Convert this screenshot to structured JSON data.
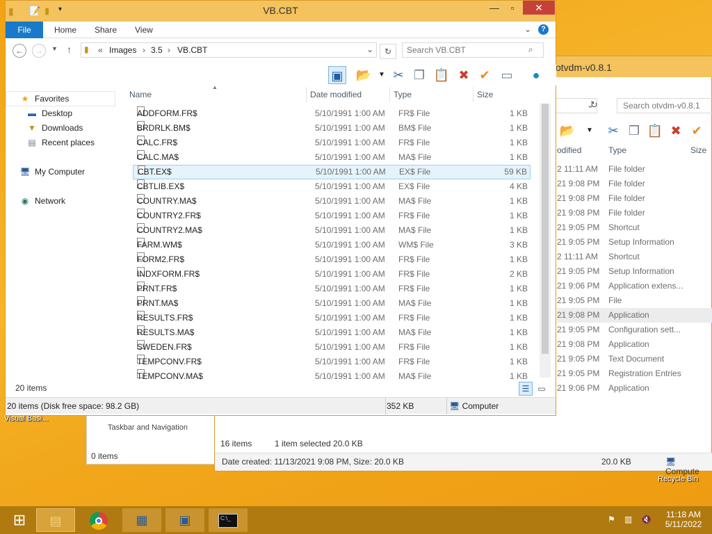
{
  "desktop": {
    "recycle_bin": "Recycle Bin",
    "visual_basic_label": "Visual Basi...",
    "taskbar_nav_label": "Taskbar and Navigation",
    "back_window_items": "0 items"
  },
  "bg_window": {
    "title": "otvdm-v0.8.1",
    "search_placeholder": "Search otvdm-v0.8.1",
    "col_modified": "odified",
    "col_type": "Type",
    "col_size": "Size",
    "rows": [
      {
        "date": "2 11:11 AM",
        "type": "File folder"
      },
      {
        "date": "21 9:08 PM",
        "type": "File folder"
      },
      {
        "date": "21 9:08 PM",
        "type": "File folder"
      },
      {
        "date": "21 9:08 PM",
        "type": "File folder"
      },
      {
        "date": "21 9:05 PM",
        "type": "Shortcut"
      },
      {
        "date": "21 9:05 PM",
        "type": "Setup Information"
      },
      {
        "date": "2 11:11 AM",
        "type": "Shortcut"
      },
      {
        "date": "21 9:05 PM",
        "type": "Setup Information"
      },
      {
        "date": "21 9:06 PM",
        "type": "Application extens..."
      },
      {
        "date": "21 9:05 PM",
        "type": "File"
      },
      {
        "date": "21 9:08 PM",
        "type": "Application"
      },
      {
        "date": "21 9:05 PM",
        "type": "Configuration sett..."
      },
      {
        "date": "21 9:08 PM",
        "type": "Application"
      },
      {
        "date": "21 9:05 PM",
        "type": "Text Document"
      },
      {
        "date": "21 9:05 PM",
        "type": "Registration Entries"
      },
      {
        "date": "21 9:06 PM",
        "type": "Application"
      }
    ],
    "status_items": "16 items",
    "status_selected": "1 item selected  20.0 KB",
    "details": "Date created: 11/13/2021 9:08 PM, Size: 20.0 KB",
    "details_size": "20.0 KB",
    "details_location": "Compute"
  },
  "window": {
    "title": "VB.CBT",
    "ribbon": {
      "file": "File",
      "home": "Home",
      "share": "Share",
      "view": "View"
    },
    "breadcrumb": {
      "prefix": "«",
      "parts": [
        "Images",
        "3.5",
        "VB.CBT"
      ]
    },
    "search_placeholder": "Search VB.CBT",
    "nav": {
      "favorites": "Favorites",
      "desktop": "Desktop",
      "downloads": "Downloads",
      "recent": "Recent places",
      "computer": "My Computer",
      "network": "Network"
    },
    "columns": {
      "name": "Name",
      "date": "Date modified",
      "type": "Type",
      "size": "Size"
    },
    "files": [
      {
        "name": "ADDFORM.FR$",
        "date": "5/10/1991 1:00 AM",
        "type": "FR$ File",
        "size": "1 KB"
      },
      {
        "name": "BRDRLK.BM$",
        "date": "5/10/1991 1:00 AM",
        "type": "BM$ File",
        "size": "1 KB"
      },
      {
        "name": "CALC.FR$",
        "date": "5/10/1991 1:00 AM",
        "type": "FR$ File",
        "size": "1 KB"
      },
      {
        "name": "CALC.MA$",
        "date": "5/10/1991 1:00 AM",
        "type": "MA$ File",
        "size": "1 KB"
      },
      {
        "name": "CBT.EX$",
        "date": "5/10/1991 1:00 AM",
        "type": "EX$ File",
        "size": "59 KB"
      },
      {
        "name": "CBTLIB.EX$",
        "date": "5/10/1991 1:00 AM",
        "type": "EX$ File",
        "size": "4 KB"
      },
      {
        "name": "COUNTRY.MA$",
        "date": "5/10/1991 1:00 AM",
        "type": "MA$ File",
        "size": "1 KB"
      },
      {
        "name": "COUNTRY2.FR$",
        "date": "5/10/1991 1:00 AM",
        "type": "FR$ File",
        "size": "1 KB"
      },
      {
        "name": "COUNTRY2.MA$",
        "date": "5/10/1991 1:00 AM",
        "type": "MA$ File",
        "size": "1 KB"
      },
      {
        "name": "FARM.WM$",
        "date": "5/10/1991 1:00 AM",
        "type": "WM$ File",
        "size": "3 KB"
      },
      {
        "name": "FORM2.FR$",
        "date": "5/10/1991 1:00 AM",
        "type": "FR$ File",
        "size": "1 KB"
      },
      {
        "name": "INDXFORM.FR$",
        "date": "5/10/1991 1:00 AM",
        "type": "FR$ File",
        "size": "2 KB"
      },
      {
        "name": "PRNT.FR$",
        "date": "5/10/1991 1:00 AM",
        "type": "FR$ File",
        "size": "1 KB"
      },
      {
        "name": "PRNT.MA$",
        "date": "5/10/1991 1:00 AM",
        "type": "MA$ File",
        "size": "1 KB"
      },
      {
        "name": "RESULTS.FR$",
        "date": "5/10/1991 1:00 AM",
        "type": "FR$ File",
        "size": "1 KB"
      },
      {
        "name": "RESULTS.MA$",
        "date": "5/10/1991 1:00 AM",
        "type": "MA$ File",
        "size": "1 KB"
      },
      {
        "name": "SWEDEN.FR$",
        "date": "5/10/1991 1:00 AM",
        "type": "FR$ File",
        "size": "1 KB"
      },
      {
        "name": "TEMPCONV.FR$",
        "date": "5/10/1991 1:00 AM",
        "type": "FR$ File",
        "size": "1 KB"
      },
      {
        "name": "TEMPCONV.MA$",
        "date": "5/10/1991 1:00 AM",
        "type": "MA$ File",
        "size": "1 KB"
      }
    ],
    "selected_index": 4,
    "item_count": "20 items",
    "status_left": "20 items (Disk free space: 98.2 GB)",
    "status_size": "352 KB",
    "status_location": "Computer"
  },
  "taskbar": {
    "time": "11:18 AM",
    "date": "5/11/2022"
  },
  "colors": {
    "desktop": "#f2a81c",
    "titlebar": "#f4c35e",
    "close": "#c7413b",
    "file_tab": "#1979ca",
    "selection": "#e5f3fb",
    "taskbar": "#b07a10"
  }
}
